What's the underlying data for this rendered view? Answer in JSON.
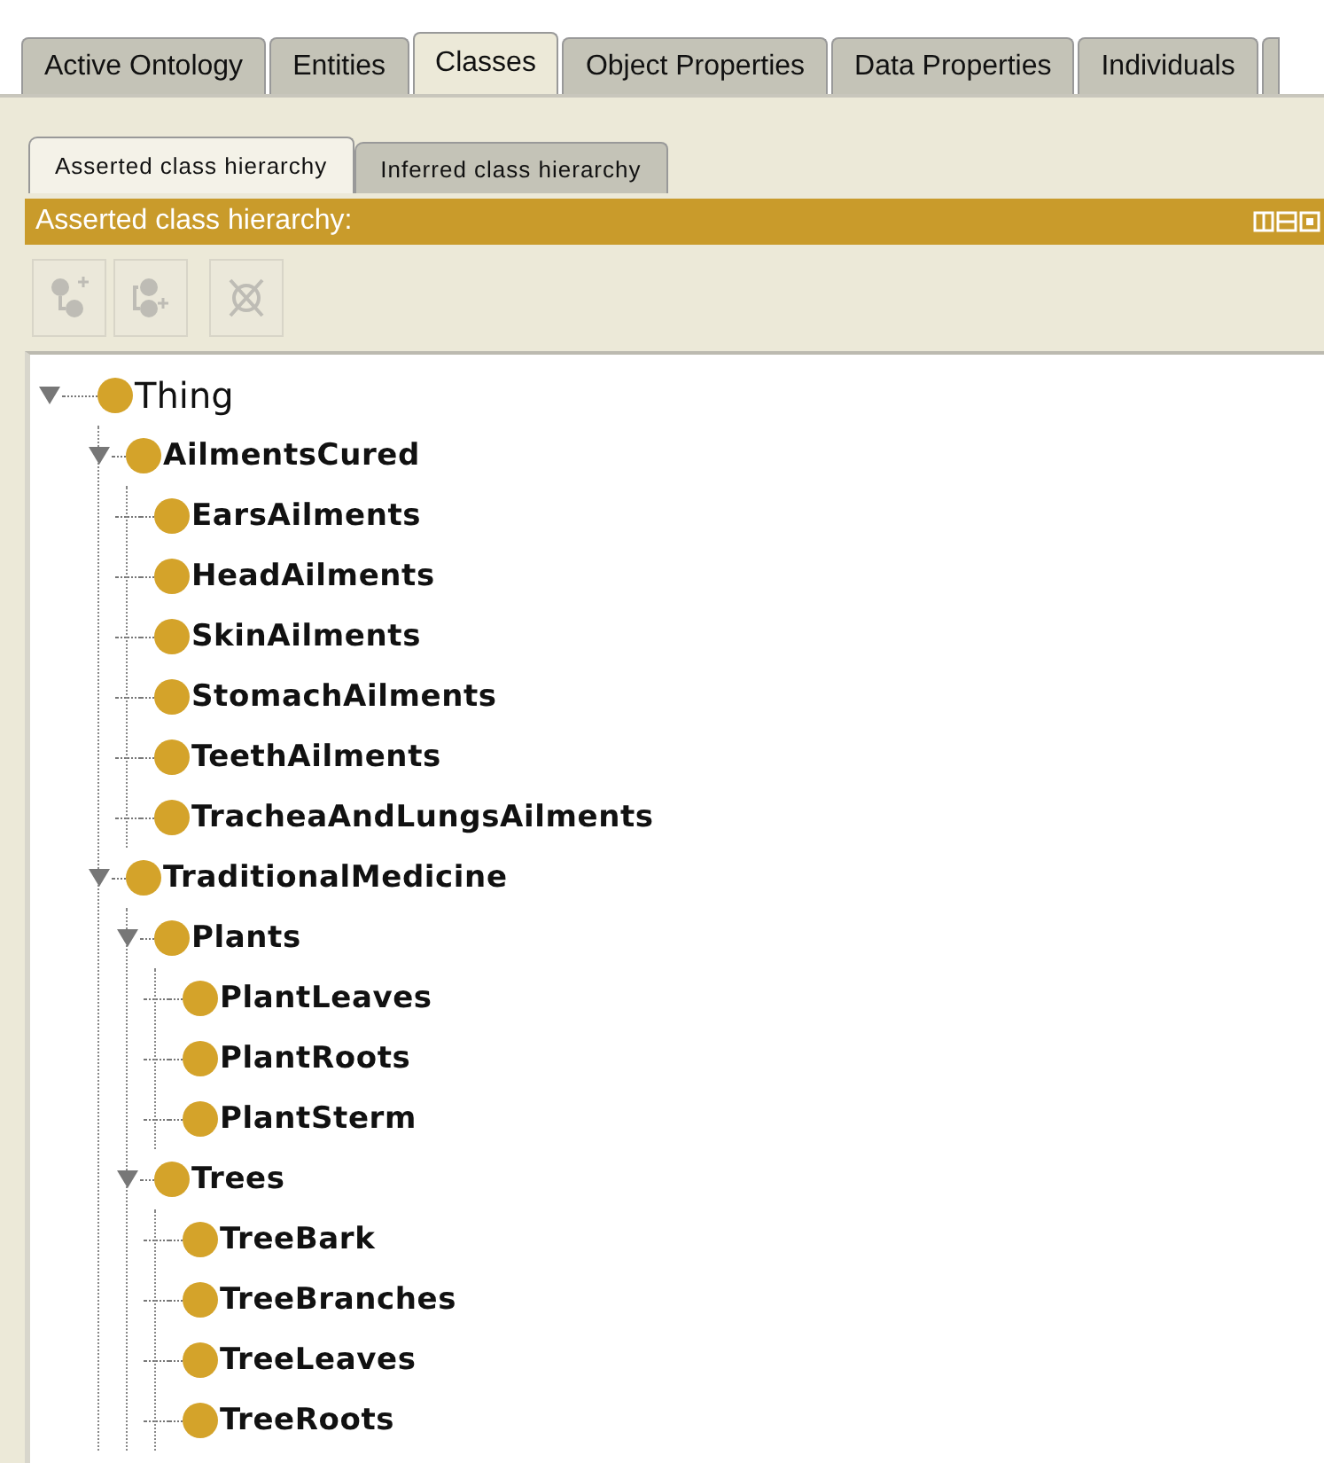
{
  "tabs": [
    {
      "label": "Active Ontology",
      "selected": false
    },
    {
      "label": "Entities",
      "selected": false
    },
    {
      "label": "Classes",
      "selected": true
    },
    {
      "label": "Object Properties",
      "selected": false
    },
    {
      "label": "Data Properties",
      "selected": false
    },
    {
      "label": "Individuals",
      "selected": false
    }
  ],
  "sub_tabs": [
    {
      "label": "Asserted class hierarchy",
      "selected": true
    },
    {
      "label": "Inferred class hierarchy",
      "selected": false
    }
  ],
  "view": {
    "title": "Asserted class hierarchy:"
  },
  "toolbar": [
    {
      "kind": "add_subclass",
      "disabled": true
    },
    {
      "kind": "add_sibling",
      "disabled": true
    },
    {
      "kind": "delete",
      "disabled": true
    }
  ],
  "tree": [
    {
      "label": "Thing",
      "expanded": true,
      "children": [
        {
          "label": "AilmentsCured",
          "expanded": true,
          "children": [
            {
              "label": "EarsAilments"
            },
            {
              "label": "HeadAilments"
            },
            {
              "label": "SkinAilments"
            },
            {
              "label": "StomachAilments"
            },
            {
              "label": "TeethAilments"
            },
            {
              "label": "TracheaAndLungsAilments"
            }
          ]
        },
        {
          "label": "TraditionalMedicine",
          "expanded": true,
          "children": [
            {
              "label": "Plants",
              "expanded": true,
              "children": [
                {
                  "label": "PlantLeaves"
                },
                {
                  "label": "PlantRoots"
                },
                {
                  "label": "PlantSterm"
                }
              ]
            },
            {
              "label": "Trees",
              "expanded": true,
              "children": [
                {
                  "label": "TreeBark"
                },
                {
                  "label": "TreeBranches"
                },
                {
                  "label": "TreeLeaves"
                },
                {
                  "label": "TreeRoots"
                }
              ]
            }
          ]
        }
      ]
    }
  ]
}
